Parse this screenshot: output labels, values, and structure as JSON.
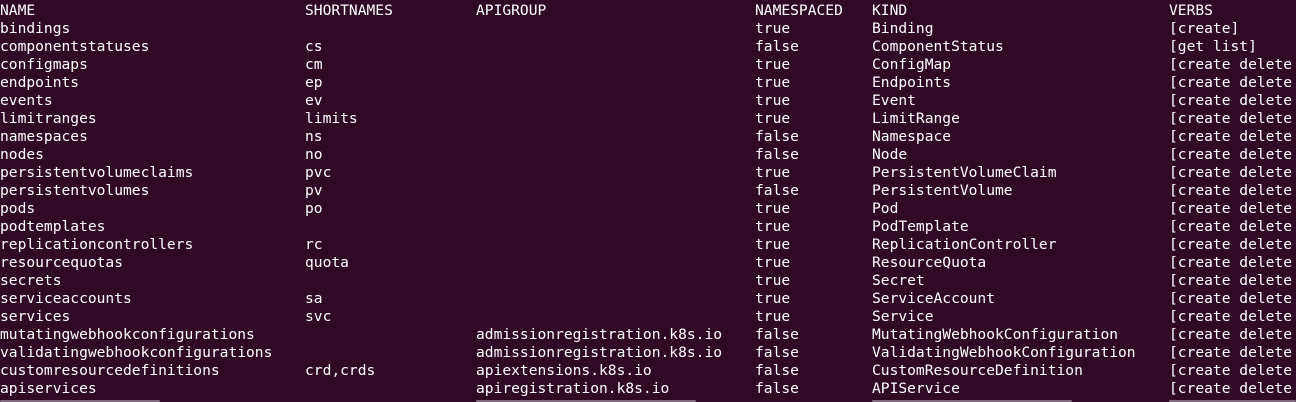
{
  "terminal": {
    "colors": {
      "background": "#300a24",
      "foreground": "#ffffff",
      "prompt_fragment_red": "#ef2929",
      "prompt_fragment_dim": "#c8b8c4"
    },
    "headers": {
      "name": "NAME",
      "shortnames": "SHORTNAMES",
      "apigroup": "APIGROUP",
      "namespaced": "NAMESPACED",
      "kind": "KIND",
      "verbs": "VERBS"
    },
    "rows": [
      {
        "name": "bindings",
        "shortnames": "",
        "apigroup": "",
        "namespaced": "true",
        "kind": "Binding",
        "verbs": "[create]"
      },
      {
        "name": "componentstatuses",
        "shortnames": "cs",
        "apigroup": "",
        "namespaced": "false",
        "kind": "ComponentStatus",
        "verbs": "[get list]"
      },
      {
        "name": "configmaps",
        "shortnames": "cm",
        "apigroup": "",
        "namespaced": "true",
        "kind": "ConfigMap",
        "verbs": "[create delete"
      },
      {
        "name": "endpoints",
        "shortnames": "ep",
        "apigroup": "",
        "namespaced": "true",
        "kind": "Endpoints",
        "verbs": "[create delete"
      },
      {
        "name": "events",
        "shortnames": "ev",
        "apigroup": "",
        "namespaced": "true",
        "kind": "Event",
        "verbs": "[create delete"
      },
      {
        "name": "limitranges",
        "shortnames": "limits",
        "apigroup": "",
        "namespaced": "true",
        "kind": "LimitRange",
        "verbs": "[create delete"
      },
      {
        "name": "namespaces",
        "shortnames": "ns",
        "apigroup": "",
        "namespaced": "false",
        "kind": "Namespace",
        "verbs": "[create delete"
      },
      {
        "name": "nodes",
        "shortnames": "no",
        "apigroup": "",
        "namespaced": "false",
        "kind": "Node",
        "verbs": "[create delete"
      },
      {
        "name": "persistentvolumeclaims",
        "shortnames": "pvc",
        "apigroup": "",
        "namespaced": "true",
        "kind": "PersistentVolumeClaim",
        "verbs": "[create delete"
      },
      {
        "name": "persistentvolumes",
        "shortnames": "pv",
        "apigroup": "",
        "namespaced": "false",
        "kind": "PersistentVolume",
        "verbs": "[create delete"
      },
      {
        "name": "pods",
        "shortnames": "po",
        "apigroup": "",
        "namespaced": "true",
        "kind": "Pod",
        "verbs": "[create delete"
      },
      {
        "name": "podtemplates",
        "shortnames": "",
        "apigroup": "",
        "namespaced": "true",
        "kind": "PodTemplate",
        "verbs": "[create delete"
      },
      {
        "name": "replicationcontrollers",
        "shortnames": "rc",
        "apigroup": "",
        "namespaced": "true",
        "kind": "ReplicationController",
        "verbs": "[create delete"
      },
      {
        "name": "resourcequotas",
        "shortnames": "quota",
        "apigroup": "",
        "namespaced": "true",
        "kind": "ResourceQuota",
        "verbs": "[create delete"
      },
      {
        "name": "secrets",
        "shortnames": "",
        "apigroup": "",
        "namespaced": "true",
        "kind": "Secret",
        "verbs": "[create delete"
      },
      {
        "name": "serviceaccounts",
        "shortnames": "sa",
        "apigroup": "",
        "namespaced": "true",
        "kind": "ServiceAccount",
        "verbs": "[create delete"
      },
      {
        "name": "services",
        "shortnames": "svc",
        "apigroup": "",
        "namespaced": "true",
        "kind": "Service",
        "verbs": "[create delete"
      },
      {
        "name": "mutatingwebhookconfigurations",
        "shortnames": "",
        "apigroup": "admissionregistration.k8s.io",
        "namespaced": "false",
        "kind": "MutatingWebhookConfiguration",
        "verbs": "[create delete"
      },
      {
        "name": "validatingwebhookconfigurations",
        "shortnames": "",
        "apigroup": "admissionregistration.k8s.io",
        "namespaced": "false",
        "kind": "ValidatingWebhookConfiguration",
        "verbs": "[create delete"
      },
      {
        "name": "customresourcedefinitions",
        "shortnames": "crd,crds",
        "apigroup": "apiextensions.k8s.io",
        "namespaced": "false",
        "kind": "CustomResourceDefinition",
        "verbs": "[create delete"
      },
      {
        "name": "apiservices",
        "shortnames": "",
        "apigroup": "apiregistration.k8s.io",
        "namespaced": "false",
        "kind": "APIService",
        "verbs": "[create delete"
      }
    ]
  }
}
